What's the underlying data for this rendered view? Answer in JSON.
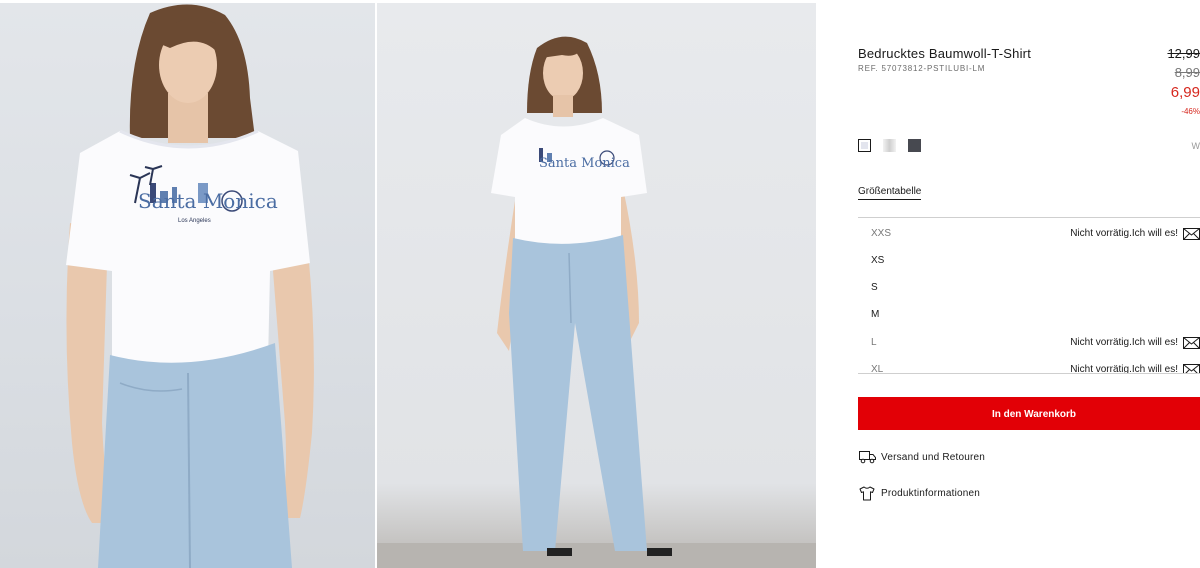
{
  "product": {
    "title": "Bedrucktes Baumwoll-T-Shirt",
    "ref": "REF. 57073812-PSTILUBI-LM",
    "price_original": "12,99",
    "price_previous": "8,99",
    "price_current": "6,99",
    "discount": "-46%",
    "colors_label_partial": "W",
    "print_text": "Santa Monica",
    "print_subtext": "Los Angeles"
  },
  "colors": {
    "accent_red": "#e20006",
    "swatches": [
      "#e3e5ee",
      "#cfcfcf",
      "#474950"
    ]
  },
  "size_chart_label": "Größentabelle",
  "sizes": [
    {
      "label": "XXS",
      "status": "Nicht vorrätig.Ich will es!",
      "available": false
    },
    {
      "label": "XS",
      "status": "",
      "available": true
    },
    {
      "label": "S",
      "status": "",
      "available": true
    },
    {
      "label": "M",
      "status": "",
      "available": true
    },
    {
      "label": "L",
      "status": "Nicht vorrätig.Ich will es!",
      "available": false
    },
    {
      "label": "XL",
      "status": "Nicht vorrätig.Ich will es!",
      "available": false
    }
  ],
  "cart_button": "In den Warenkorb",
  "links": {
    "shipping": "Versand und Retouren",
    "product_info": "Produktinformationen"
  },
  "icons": {
    "size_unavailable": "envelope-icon",
    "shipping": "truck-icon",
    "product_info": "tshirt-icon"
  }
}
